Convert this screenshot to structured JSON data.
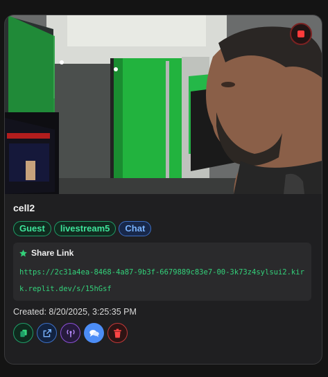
{
  "card": {
    "title": "cell2",
    "badges": [
      "Guest",
      "livestream5",
      "Chat"
    ],
    "share": {
      "heading": "Share Link",
      "url": "https://2c31a4ea-8468-4a87-9b3f-6679889c83e7-00-3k73z4sylsui2.kirk.replit.dev/s/15hGsf"
    },
    "created": "Created: 8/20/2025, 3:25:35 PM"
  },
  "icons": {
    "stop": "stop-icon",
    "share_heading": "star-icon",
    "actions": [
      "copy-icon",
      "external-link-icon",
      "broadcast-icon",
      "chat-icon",
      "trash-icon"
    ]
  },
  "colors": {
    "accent_green": "#33d17a",
    "accent_blue": "#4c8df6",
    "accent_purple": "#8a4fd6",
    "danger_red": "#ff3b3b",
    "card_bg": "#1f1f21",
    "page_bg": "#141414"
  }
}
